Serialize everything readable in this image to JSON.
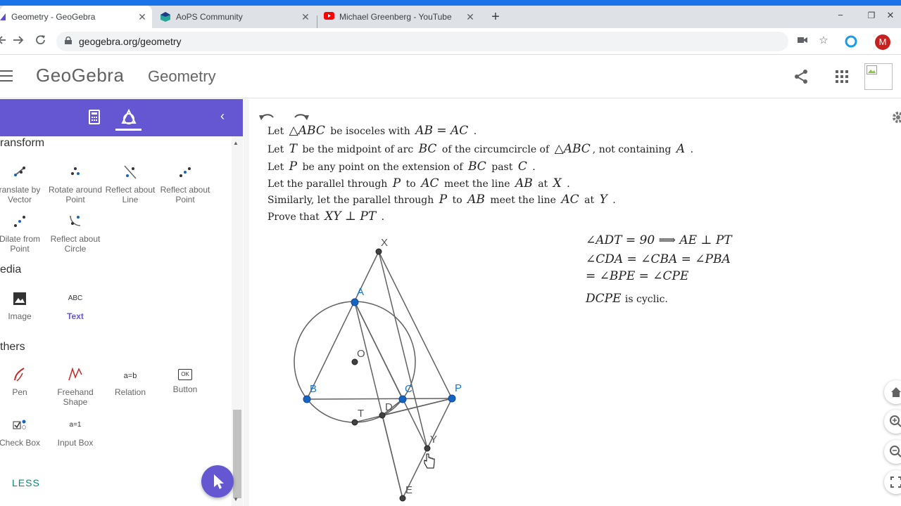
{
  "browser": {
    "tabs": [
      {
        "title": "Geometry - GeoGebra",
        "icon": "geogebra-icon",
        "active": true
      },
      {
        "title": "AoPS Community",
        "icon": "aops-icon",
        "active": false
      },
      {
        "title": "Michael Greenberg - YouTube",
        "icon": "youtube-icon",
        "active": false
      }
    ],
    "close_glyph": "✕",
    "newtab_glyph": "+",
    "url": "geogebra.org/geometry",
    "avatar_letter": "M",
    "window_controls": [
      "−",
      "❐",
      "✕"
    ]
  },
  "header": {
    "logo": "GeoGebra",
    "title": "Geometry"
  },
  "panel": {
    "collapse_glyph": "‹",
    "sections": {
      "transform": "ransform",
      "media": "edia",
      "others": "thers"
    },
    "tools": {
      "translate": "ranslate by Vector",
      "rotate": "Rotate around Point",
      "reflect_line": "Reflect about Line",
      "reflect_point": "Reflect about Point",
      "dilate": "Dilate from Point",
      "reflect_circle": "Reflect about Circle",
      "image": "Image",
      "text": "Text",
      "pen": "Pen",
      "freehand": "Freehand Shape",
      "relation": "Relation",
      "button": "Button",
      "checkbox": "Check Box",
      "inputbox": "Input Box"
    },
    "tool_glyphs": {
      "text": "ABC",
      "relation": "a=b",
      "button": "OK",
      "inputbox": "a=1"
    },
    "less": "LESS"
  },
  "statement": {
    "l1": {
      "a": "Let",
      "b": "△ABC",
      "c": "be isoceles with",
      "d": "AB = AC",
      "e": "."
    },
    "l2": {
      "a": "Let",
      "b": "T",
      "c": "be the midpoint of arc",
      "d": "BC",
      "e": "of the circumcircle of",
      "f": "△ABC",
      "g": ", not containing",
      "h": "A",
      "i": "."
    },
    "l3": {
      "a": "Let",
      "b": "P",
      "c": "be any point on the extension of",
      "d": "BC",
      "e": "past",
      "f": "C",
      "g": "."
    },
    "l4": {
      "a": "Let the parallel through",
      "b": "P",
      "c": "to",
      "d": "AC",
      "e": "meet the line",
      "f": "AB",
      "g": "at",
      "h": "X",
      "i": "."
    },
    "l5": {
      "a": "Similarly, let the parallel through",
      "b": "P",
      "c": "to",
      "d": "AB",
      "e": "meet the line",
      "f": "AC",
      "g": "at",
      "h": "Y",
      "i": "."
    },
    "l6": {
      "a": "Prove that",
      "b": "XY ⊥ PT",
      "c": "."
    }
  },
  "proof": {
    "p1": "∠ADT = 90 ⟹ AE ⊥ PT",
    "p2": "∠CDA = ∠CBA = ∠PBA",
    "p3": "= ∠BPE = ∠CPE",
    "p4a": "DCPE",
    "p4b": "is cyclic."
  },
  "figure": {
    "points": {
      "X": "X",
      "A": "A",
      "O": "O",
      "B": "B",
      "C": "C",
      "P": "P",
      "T": "T",
      "D": "D",
      "Y": "Y",
      "E": "E"
    }
  },
  "colors": {
    "accent": "#6557d2",
    "chrome_blue": "#1a73e8",
    "point_blue": "#1565c0",
    "point_dark": "#424242",
    "less_green": "#00897b"
  }
}
